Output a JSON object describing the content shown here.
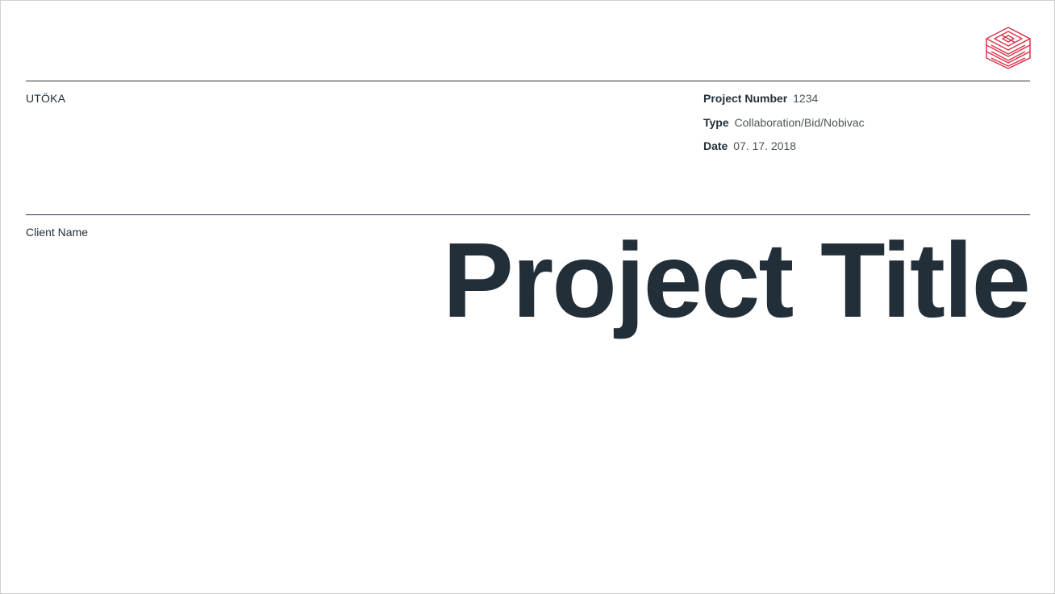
{
  "company": {
    "name": "UTÖKA"
  },
  "project": {
    "number_label": "Project Number",
    "number_value": "1234",
    "type_label": "Type",
    "type_value": "Collaboration/Bid/Nobivac",
    "date_label": "Date",
    "date_value": "07. 17. 2018"
  },
  "client": {
    "name": "Client Name"
  },
  "title": "Project Title",
  "logo": {
    "icon": "stacked-maze-logo-icon",
    "color": "#d9374c"
  },
  "colors": {
    "text": "#232f38",
    "rule": "#2a343c",
    "accent": "#d9374c"
  }
}
